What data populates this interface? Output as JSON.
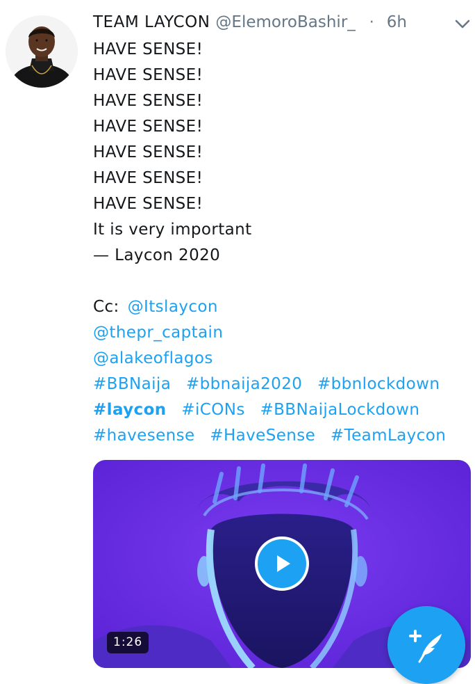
{
  "tweet": {
    "display_name": "TEAM LAYCON",
    "handle": "@ElemoroBashir_",
    "separator": "·",
    "time": "6h",
    "avatar_icon": "profile-photo",
    "menu_icon": "chevron-down-icon",
    "lines": [
      "HAVE SENSE!",
      "HAVE SENSE!",
      "HAVE SENSE!",
      "HAVE SENSE!",
      "HAVE SENSE!",
      "HAVE SENSE!",
      "HAVE SENSE!",
      "It is very important",
      "— Laycon 2020"
    ],
    "cc_label": "Cc:",
    "mentions": [
      "@Itslaycon",
      "@thepr_captain",
      "@alakeoflagos"
    ],
    "hashtags": [
      "#BBNaija",
      "#bbnaija2020",
      "#bbnlockdown",
      "#laycon",
      "#iCONs",
      "#BBNaijaLockdown",
      "#havesense",
      "#HaveSense",
      "#TeamLaycon"
    ],
    "video": {
      "duration": "1:26",
      "play_icon": "play-icon"
    }
  },
  "compose_button": {
    "icon": "compose-tweet-icon"
  },
  "colors": {
    "link": "#1da1f2",
    "muted": "#657786",
    "text": "#14171a",
    "video_bg": "#6a2fe0"
  }
}
